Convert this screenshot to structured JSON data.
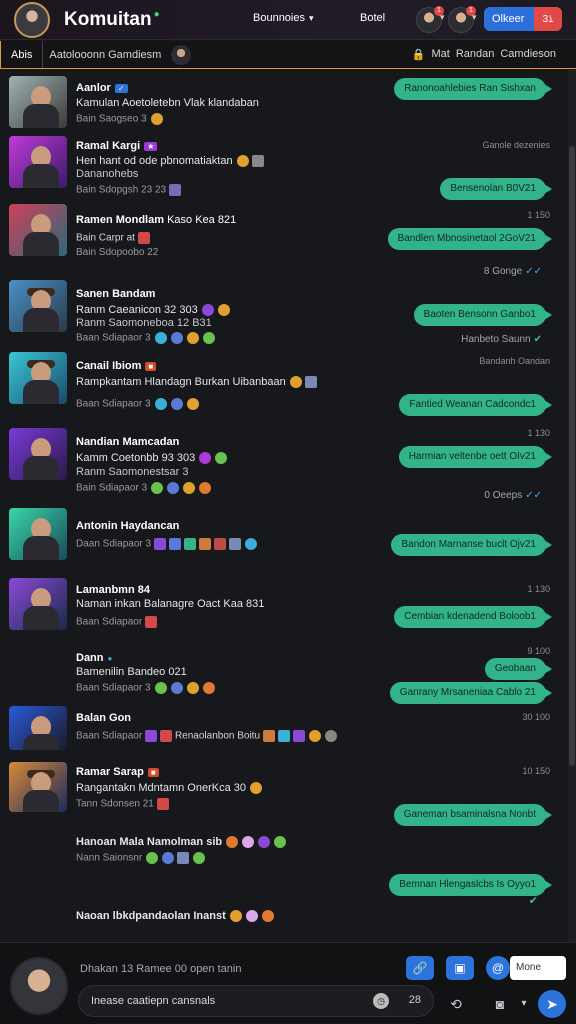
{
  "header": {
    "title": "Komuitan",
    "menu_label": "Bounnoies",
    "setting_label": "Botel",
    "button_label": "Olkeer",
    "button_count": "31"
  },
  "subbar": {
    "tab_label": "Abis",
    "text": "Aatolooonn Gamdiesm",
    "right_1": "Mat",
    "right_2": "Randan",
    "right_3": "Camdieson"
  },
  "feed": [
    {
      "name": "Aanlor",
      "tag": "",
      "line": "Kamulan Aoetoletebn Vlak klandaban",
      "meta": "Bain Saogseo 3",
      "bubble": "Ranonoahlebies Ran Sishxan",
      "time": ""
    },
    {
      "name": "Ramal Kargi",
      "tag": "",
      "line": "Hen hant od ode pbnomatiaktan",
      "line2": "Dananohebs",
      "meta": "Bain Sdopgsh 23 23",
      "bubble": "Bensenolan B0V21",
      "time": "Ganole dezenies"
    },
    {
      "name": "Ramen Mondlam",
      "tag": "",
      "line": "Kaso Kea 821",
      "meta": "Bain Carpr at",
      "meta2": "Bain Sdopoobo 22",
      "bubble": "Bandlen Mbnosinetaol 2GoV21",
      "time": "1 150"
    },
    {
      "name": "Sanen Bandam",
      "tag": "",
      "line": "Ranm Caeanicon 32 303",
      "line2": "Ranm Saomoneboa 12 B31",
      "meta": "Baan Sdiapaor 3",
      "bubble": "Baoten Bensonn Ganbo1",
      "time": "8 Gonge",
      "reads": "Hanbeto Saunn"
    },
    {
      "name": "Canail Ibiom",
      "tag": "",
      "line": "Rampkantam Hlandagn Burkan Uibanbaan",
      "meta": "Baan Sdiapaor 3",
      "bubble": "Fantied Weanan Cadcondc1",
      "time": "Bandanh Oandan"
    },
    {
      "name": "Nandian Mamcadan",
      "tag": "",
      "line": "Kamm Coetonbb 93 303",
      "line2": "Ranm Saomonestsar 3",
      "meta": "Bain Sdiapaor 3",
      "bubble": "Harmian veltenbe oett OIv21",
      "time": "1 130"
    },
    {
      "name": "Antonin Haydancan",
      "tag": "",
      "line": "",
      "meta": "Daan Sdiapaor 3",
      "bubble": "Bandon Marnanse buclt Ojv21",
      "time": "0 Oeeps",
      "reads": ""
    },
    {
      "name": "Lamanbmn 84",
      "tag": "",
      "line": "Naman inkan Balanagre Oact Kaa 831",
      "meta": "Baan Sdiapaor",
      "bubble": "Cembian kdenadend Boloob1",
      "time": "1 130"
    },
    {
      "name": "Dann",
      "tag": "",
      "line": "Bamenilin Bandeo 021",
      "meta": "Baan Sdiapaor 3",
      "bubble": "Geobaan",
      "bubble2": "Ganrany Mrsaneniaa Cablo 21",
      "time": "9 100"
    },
    {
      "name": "Balan Gon",
      "tag": "",
      "line": "",
      "meta": "Baan Sdiapaor",
      "meta_tail": "Renaolanbon Boitu",
      "bubble": "",
      "time": "30 100"
    },
    {
      "name": "Ramar Sarap",
      "tag": "",
      "line": "Rangantakn Mdntamn OnerKca 30",
      "meta": "Tann Sdonsen 21",
      "bubble": "Ganeman bsaminalsna Nonbt",
      "time": "10 150"
    },
    {
      "name": "",
      "tag": "",
      "line": "Hanoan Mala Namolman sib",
      "meta": "Nann Saionsnr",
      "bubble": "Bemnan Hlengaslcbs Is Oyyo1",
      "time": ""
    },
    {
      "name": "",
      "tag": "",
      "line": "Naoan lbkdpandaolan Inanst",
      "meta": "",
      "bubble": "",
      "time": ""
    }
  ],
  "composer": {
    "hint": "Dhakan 13 Ramee 00 open tanin",
    "placeholder": "Inease caatiepn cansnals",
    "count": "28",
    "mode": "Mone"
  },
  "colors": {
    "accent": "#2c73dc",
    "bubble": "#33b38a",
    "badge": "#e04848",
    "underline": "#d99a3c"
  }
}
